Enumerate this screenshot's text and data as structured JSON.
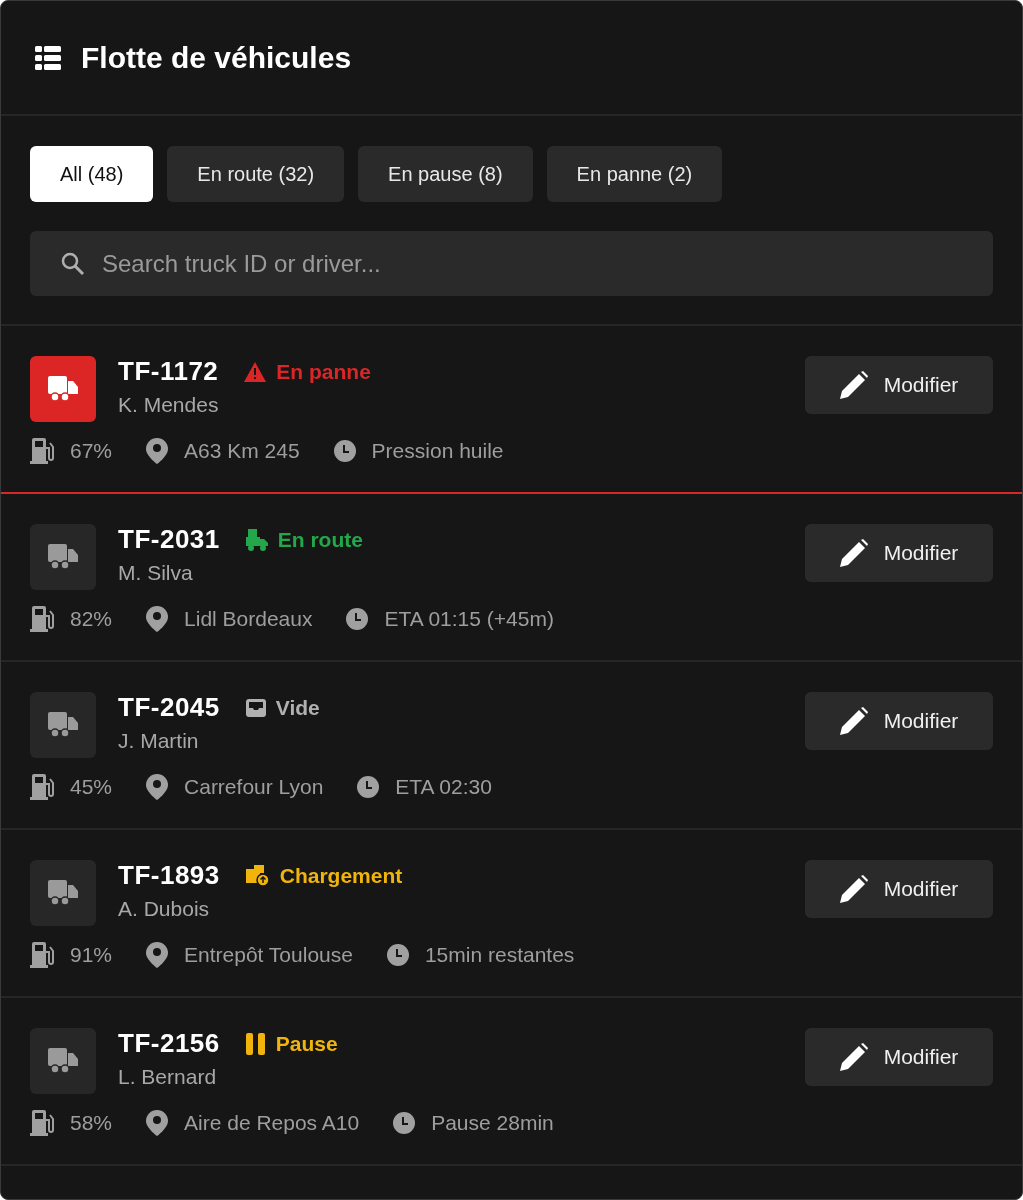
{
  "header": {
    "title": "Flotte de véhicules"
  },
  "tabs": [
    {
      "label": "All (48)",
      "selected": true
    },
    {
      "label": "En route (32)",
      "selected": false
    },
    {
      "label": "En pause (8)",
      "selected": false
    },
    {
      "label": "En panne (2)",
      "selected": false
    }
  ],
  "search": {
    "placeholder": "Search truck ID or driver..."
  },
  "vehicles": [
    {
      "id": "TF-1172",
      "driver": "K. Mendes",
      "status": {
        "kind": "breakdown",
        "label": "En panne"
      },
      "fuel": "67%",
      "location": "A63 Km 245",
      "info": "Pression huile",
      "button": "Modifier"
    },
    {
      "id": "TF-2031",
      "driver": "M. Silva",
      "status": {
        "kind": "en_route",
        "label": "En route"
      },
      "fuel": "82%",
      "location": "Lidl Bordeaux",
      "info": "ETA 01:15 (+45m)",
      "button": "Modifier"
    },
    {
      "id": "TF-2045",
      "driver": "J. Martin",
      "status": {
        "kind": "empty",
        "label": "Vide"
      },
      "fuel": "45%",
      "location": "Carrefour Lyon",
      "info": "ETA 02:30",
      "button": "Modifier"
    },
    {
      "id": "TF-1893",
      "driver": "A. Dubois",
      "status": {
        "kind": "loading",
        "label": "Chargement"
      },
      "fuel": "91%",
      "location": "Entrepôt Toulouse",
      "info": "15min restantes",
      "button": "Modifier"
    },
    {
      "id": "TF-2156",
      "driver": "L. Bernard",
      "status": {
        "kind": "pause",
        "label": "Pause"
      },
      "fuel": "58%",
      "location": "Aire de Repos A10",
      "info": "Pause 28min",
      "button": "Modifier"
    }
  ]
}
